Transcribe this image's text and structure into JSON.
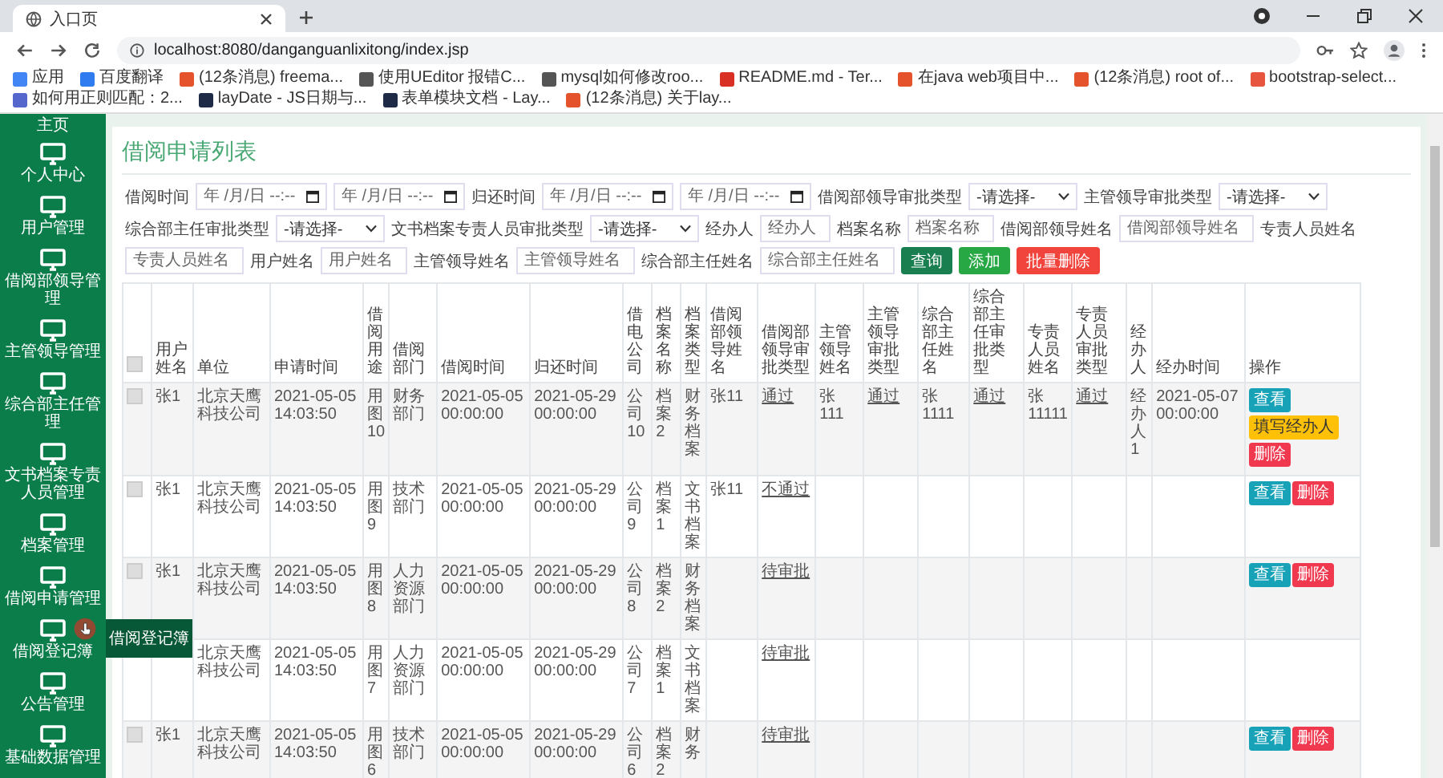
{
  "browser": {
    "tab_title": "入口页",
    "url": "localhost:8080/danganguanlixitong/index.jsp",
    "bookmarks": [
      {
        "label": "应用",
        "color": "#4285f4"
      },
      {
        "label": "百度翻译",
        "color": "#2f7bf0"
      },
      {
        "label": "(12条消息) freema...",
        "color": "#e5532d"
      },
      {
        "label": "使用UEditor 报错C...",
        "color": "#555555"
      },
      {
        "label": "mysql如何修改roo...",
        "color": "#555555"
      },
      {
        "label": "README.md - Ter...",
        "color": "#d93025"
      },
      {
        "label": "在java web项目中...",
        "color": "#e5532d"
      },
      {
        "label": "(12条消息) root of...",
        "color": "#e5532d"
      },
      {
        "label": "bootstrap-select...",
        "color": "#e8553e"
      },
      {
        "label": "如何用正则匹配：2...",
        "color": "#5566cc"
      },
      {
        "label": "layDate - JS日期与...",
        "color": "#1f2b46"
      },
      {
        "label": "表单模块文档 - Lay...",
        "color": "#1f2b46"
      },
      {
        "label": "(12条消息) 关于lay...",
        "color": "#e5532d"
      }
    ]
  },
  "sidebar": {
    "items": [
      {
        "label": "主页",
        "icon": false
      },
      {
        "label": "个人中心",
        "icon": true
      },
      {
        "label": "用户管理",
        "icon": true
      },
      {
        "label": "借阅部领导管理",
        "icon": true
      },
      {
        "label": "主管领导管理",
        "icon": true
      },
      {
        "label": "综合部主任管理",
        "icon": true
      },
      {
        "label": "文书档案专责人员管理",
        "icon": true
      },
      {
        "label": "档案管理",
        "icon": true
      },
      {
        "label": "借阅申请管理",
        "icon": true
      },
      {
        "label": "借阅登记簿",
        "icon": true,
        "flyout": "借阅登记簿"
      },
      {
        "label": "公告管理",
        "icon": true
      },
      {
        "label": "基础数据管理",
        "icon": true
      }
    ]
  },
  "page": {
    "title": "借阅申请列表",
    "filters": [
      {
        "kind": "label",
        "text": "借阅时间"
      },
      {
        "kind": "date",
        "placeholder": "年 /月/日 --:--"
      },
      {
        "kind": "date",
        "placeholder": "年 /月/日 --:--"
      },
      {
        "kind": "label",
        "text": "归还时间"
      },
      {
        "kind": "date",
        "placeholder": "年 /月/日 --:--"
      },
      {
        "kind": "date",
        "placeholder": "年 /月/日 --:--"
      },
      {
        "kind": "label",
        "text": "借阅部领导审批类型"
      },
      {
        "kind": "select",
        "value": "-请选择-"
      },
      {
        "kind": "label",
        "text": "主管领导审批类型"
      },
      {
        "kind": "select",
        "value": "-请选择-"
      },
      {
        "kind": "label",
        "text": "综合部主任审批类型"
      },
      {
        "kind": "select",
        "value": "-请选择-"
      },
      {
        "kind": "label",
        "text": "文书档案专责人员审批类型"
      },
      {
        "kind": "select",
        "value": "-请选择-"
      },
      {
        "kind": "label",
        "text": "经办人"
      },
      {
        "kind": "text",
        "placeholder": "经办人"
      },
      {
        "kind": "label",
        "text": "档案名称"
      },
      {
        "kind": "text",
        "placeholder": "档案名称"
      },
      {
        "kind": "label",
        "text": "借阅部领导姓名"
      },
      {
        "kind": "text",
        "placeholder": "借阅部领导姓名"
      },
      {
        "kind": "label",
        "text": "专责人员姓名"
      },
      {
        "kind": "text",
        "placeholder": "专责人员姓名"
      },
      {
        "kind": "label",
        "text": "用户姓名"
      },
      {
        "kind": "text",
        "placeholder": "用户姓名"
      },
      {
        "kind": "label",
        "text": "主管领导姓名"
      },
      {
        "kind": "text",
        "placeholder": "主管领导姓名"
      },
      {
        "kind": "label",
        "text": "综合部主任姓名"
      },
      {
        "kind": "text",
        "placeholder": "综合部主任姓名"
      },
      {
        "kind": "button",
        "text": "查询",
        "color": "#1a7f50"
      },
      {
        "kind": "button",
        "text": "添加",
        "color": "#28a745"
      },
      {
        "kind": "button",
        "text": "批量删除",
        "color": "#f0443c"
      }
    ]
  },
  "table": {
    "all_checked": false,
    "columns": [
      "用户姓名",
      "单位",
      "申请时间",
      "借阅用途",
      "借阅部门",
      "借阅时间",
      "归还时间",
      "借电公司",
      "档案名称",
      "档案类型",
      "借阅部领导姓名",
      "借阅部领导审批类型",
      "主管领导姓名",
      "主管领导审批类型",
      "综合部主任姓名",
      "综合部主任审批类型",
      "专责人员姓名",
      "专责人员审批类型",
      "经办人",
      "经办时间",
      "操作"
    ],
    "rows": [
      {
        "checked": false,
        "cells": [
          "张1",
          "北京天鹰科技公司",
          "2021-05-05 14:03:50",
          "用图10",
          "财务部门",
          "2021-05-05 00:00:00",
          "2021-05-29 00:00:00",
          "公司10",
          "档案2",
          "财务档案",
          "张11",
          "通过",
          "张111",
          "通过",
          "张1111",
          "通过",
          "张11111",
          "通过",
          "经办人1",
          "2021-05-07 00:00:00"
        ],
        "actions": [
          {
            "kind": "view",
            "label": "查看"
          },
          {
            "kind": "fill",
            "label": "填写经办人"
          },
          {
            "kind": "delete",
            "label": "删除"
          }
        ]
      },
      {
        "checked": false,
        "cells": [
          "张1",
          "北京天鹰科技公司",
          "2021-05-05 14:03:50",
          "用图9",
          "技术部门",
          "2021-05-05 00:00:00",
          "2021-05-29 00:00:00",
          "公司9",
          "档案1",
          "文书档案",
          "张11",
          "不通过",
          null,
          null,
          null,
          null,
          null,
          null,
          null,
          null
        ],
        "actions": [
          {
            "kind": "view",
            "label": "查看"
          },
          {
            "kind": "delete",
            "label": "删除"
          }
        ]
      },
      {
        "checked": false,
        "cells": [
          "张1",
          "北京天鹰科技公司",
          "2021-05-05 14:03:50",
          "用图8",
          "人力资源部门",
          "2021-05-05 00:00:00",
          "2021-05-29 00:00:00",
          "公司8",
          "档案2",
          "财务档案",
          null,
          "待审批",
          null,
          null,
          null,
          null,
          null,
          null,
          null,
          null
        ],
        "actions": [
          {
            "kind": "view",
            "label": "查看"
          },
          {
            "kind": "delete",
            "label": "删除"
          }
        ]
      },
      {
        "cells": [
          null,
          "北京天鹰科技公司",
          "2021-05-05 14:03:50",
          "用图7",
          "人力资源部门",
          "2021-05-05 00:00:00",
          "2021-05-29 00:00:00",
          "公司7",
          "档案1",
          "文书档案",
          null,
          "待审批",
          null,
          null,
          null,
          null,
          null,
          null,
          null,
          null
        ]
      },
      {
        "checked": false,
        "cells": [
          "张1",
          "北京天鹰科技公司",
          "2021-05-05 14:03:50",
          "用图6",
          "技术部门",
          "2021-05-05 00:00:00",
          "2021-05-29 00:00:00",
          "公司6",
          "档案2",
          "财务",
          null,
          "待审批",
          null,
          null,
          null,
          null,
          null,
          null,
          null,
          null
        ],
        "actions": [
          {
            "kind": "view",
            "label": "查看"
          },
          {
            "kind": "delete",
            "label": "删除"
          }
        ]
      }
    ]
  }
}
